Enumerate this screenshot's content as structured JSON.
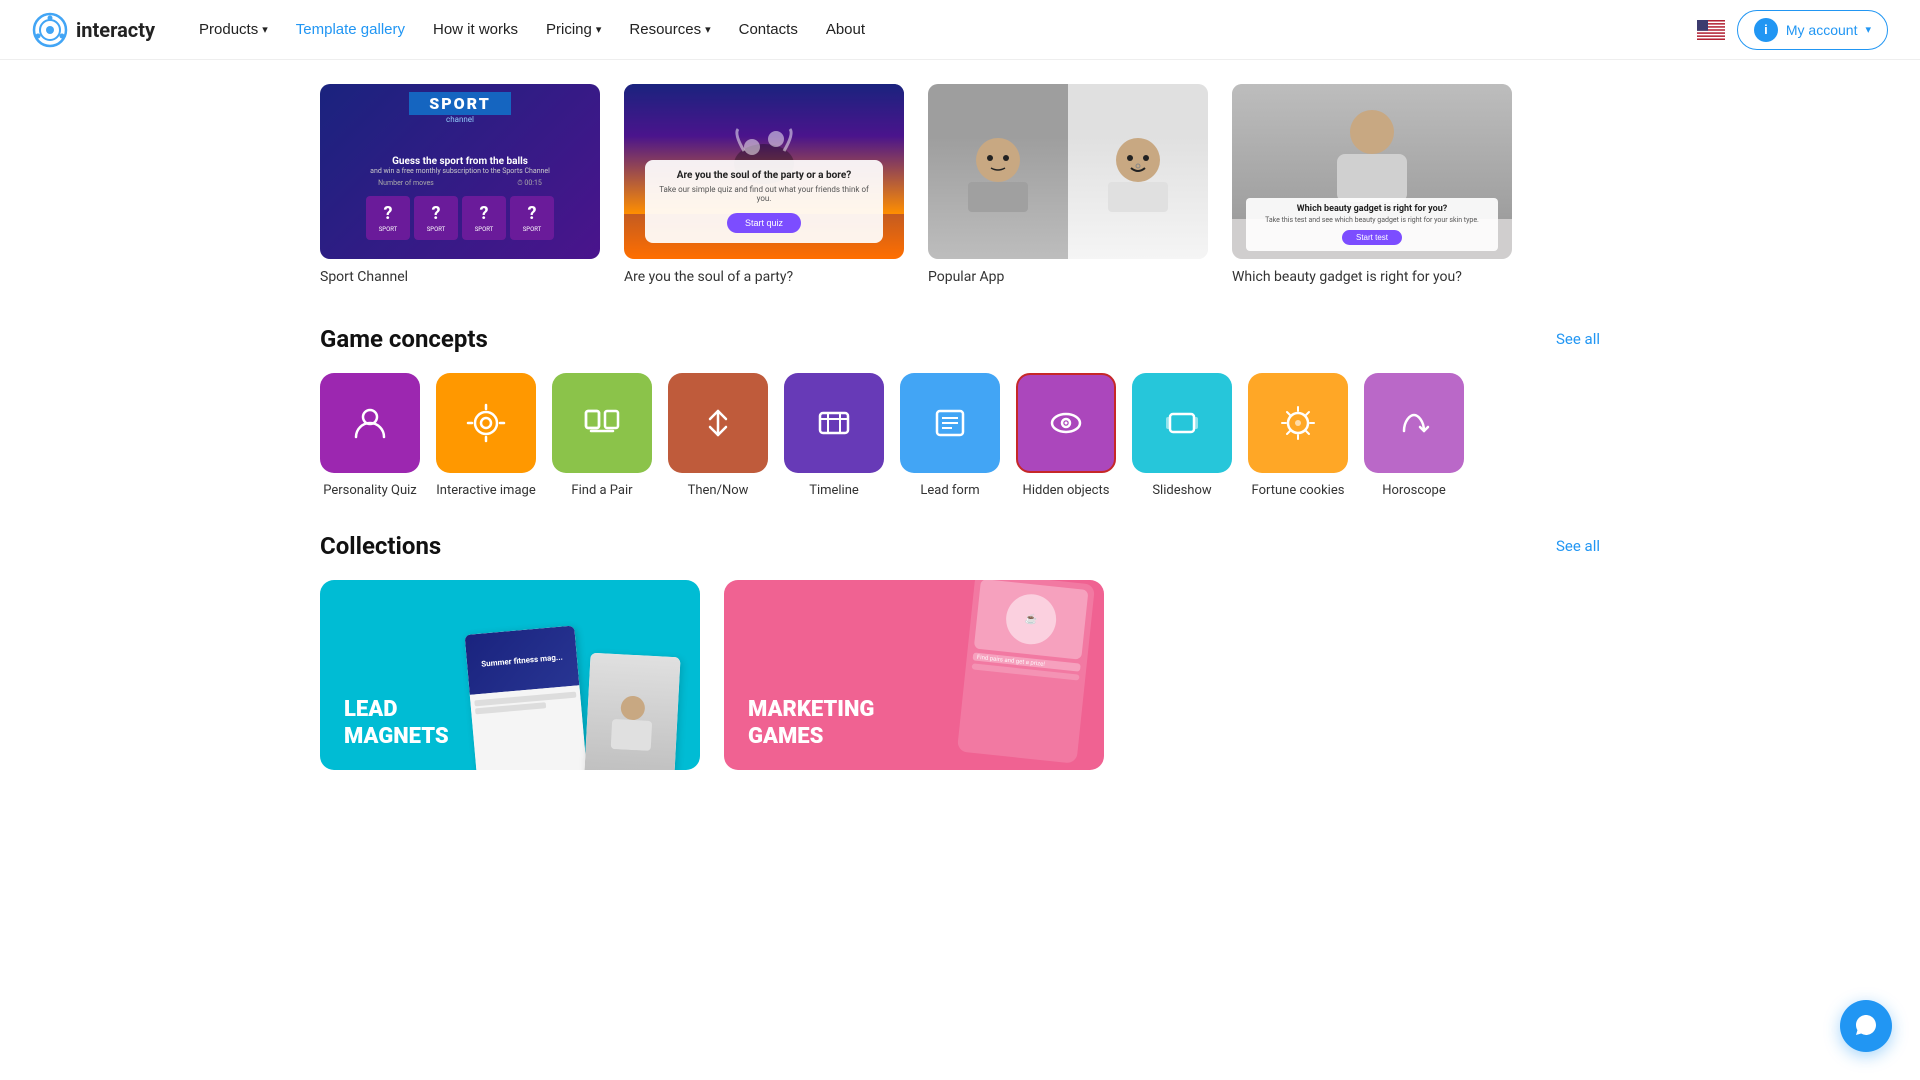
{
  "nav": {
    "logo_text": "interacty",
    "links": [
      {
        "label": "Products",
        "has_dropdown": true,
        "active": false
      },
      {
        "label": "Template gallery",
        "has_dropdown": false,
        "active": true
      },
      {
        "label": "How it works",
        "has_dropdown": false,
        "active": false
      },
      {
        "label": "Pricing",
        "has_dropdown": true,
        "active": false
      },
      {
        "label": "Resources",
        "has_dropdown": true,
        "active": false
      },
      {
        "label": "Contacts",
        "has_dropdown": false,
        "active": false
      },
      {
        "label": "About",
        "has_dropdown": false,
        "active": false
      }
    ],
    "my_account_label": "My account"
  },
  "template_cards": [
    {
      "label": "Sport Channel",
      "type": "sport"
    },
    {
      "label": "Are you the soul of a party?",
      "type": "party"
    },
    {
      "label": "Popular App",
      "type": "popular"
    },
    {
      "label": "Which beauty gadget is right for you?",
      "type": "beauty"
    }
  ],
  "sport_card": {
    "channel": "SPORT",
    "channel_sub": "channel",
    "title": "SPORT",
    "question": "Guess the sport from the balls",
    "sub": "and win a free monthly subscription to the Sports Channel",
    "moves_label": "Number of moves",
    "time": "00:15",
    "tiles": [
      "SPORT",
      "SPORT",
      "SPORT",
      "SPORT"
    ]
  },
  "party_card": {
    "question": "Are you the soul of the party or a bore?",
    "sub": "Take our simple quiz and find out what your friends think of you.",
    "btn_label": "Start quiz"
  },
  "beauty_card": {
    "title": "Which beauty gadget is right for you?",
    "sub": "Take this test and see which beauty gadget is right for your skin type.",
    "btn_label": "Start test"
  },
  "game_concepts": {
    "title": "Game concepts",
    "see_all": "See all",
    "items": [
      {
        "label": "Personality Quiz",
        "color": "#9C27B0",
        "icon": "person",
        "selected": false
      },
      {
        "label": "Interactive image",
        "color": "#FF9800",
        "icon": "interactive",
        "selected": false
      },
      {
        "label": "Find a Pair",
        "color": "#8BC34A",
        "icon": "pair",
        "selected": false
      },
      {
        "label": "Then/Now",
        "color": "#BF5B3B",
        "icon": "thennow",
        "selected": false
      },
      {
        "label": "Timeline",
        "color": "#673AB7",
        "icon": "timeline",
        "selected": false
      },
      {
        "label": "Lead form",
        "color": "#42A5F5",
        "icon": "form",
        "selected": false
      },
      {
        "label": "Hidden objects",
        "color": "#AB47BC",
        "icon": "hidden",
        "selected": true
      },
      {
        "label": "Slideshow",
        "color": "#26C6DA",
        "icon": "slideshow",
        "selected": false
      },
      {
        "label": "Fortune cookies",
        "color": "#FFA726",
        "icon": "fortune",
        "selected": false
      },
      {
        "label": "Horoscope",
        "color": "#BA68C8",
        "icon": "horoscope",
        "selected": false
      }
    ]
  },
  "collections": {
    "title": "Collections",
    "see_all": "See all",
    "items": [
      {
        "label": "LEAD\nMAGNETS",
        "type": "lead"
      },
      {
        "label": "MARKETING\nGAMES",
        "type": "marketing"
      }
    ]
  }
}
